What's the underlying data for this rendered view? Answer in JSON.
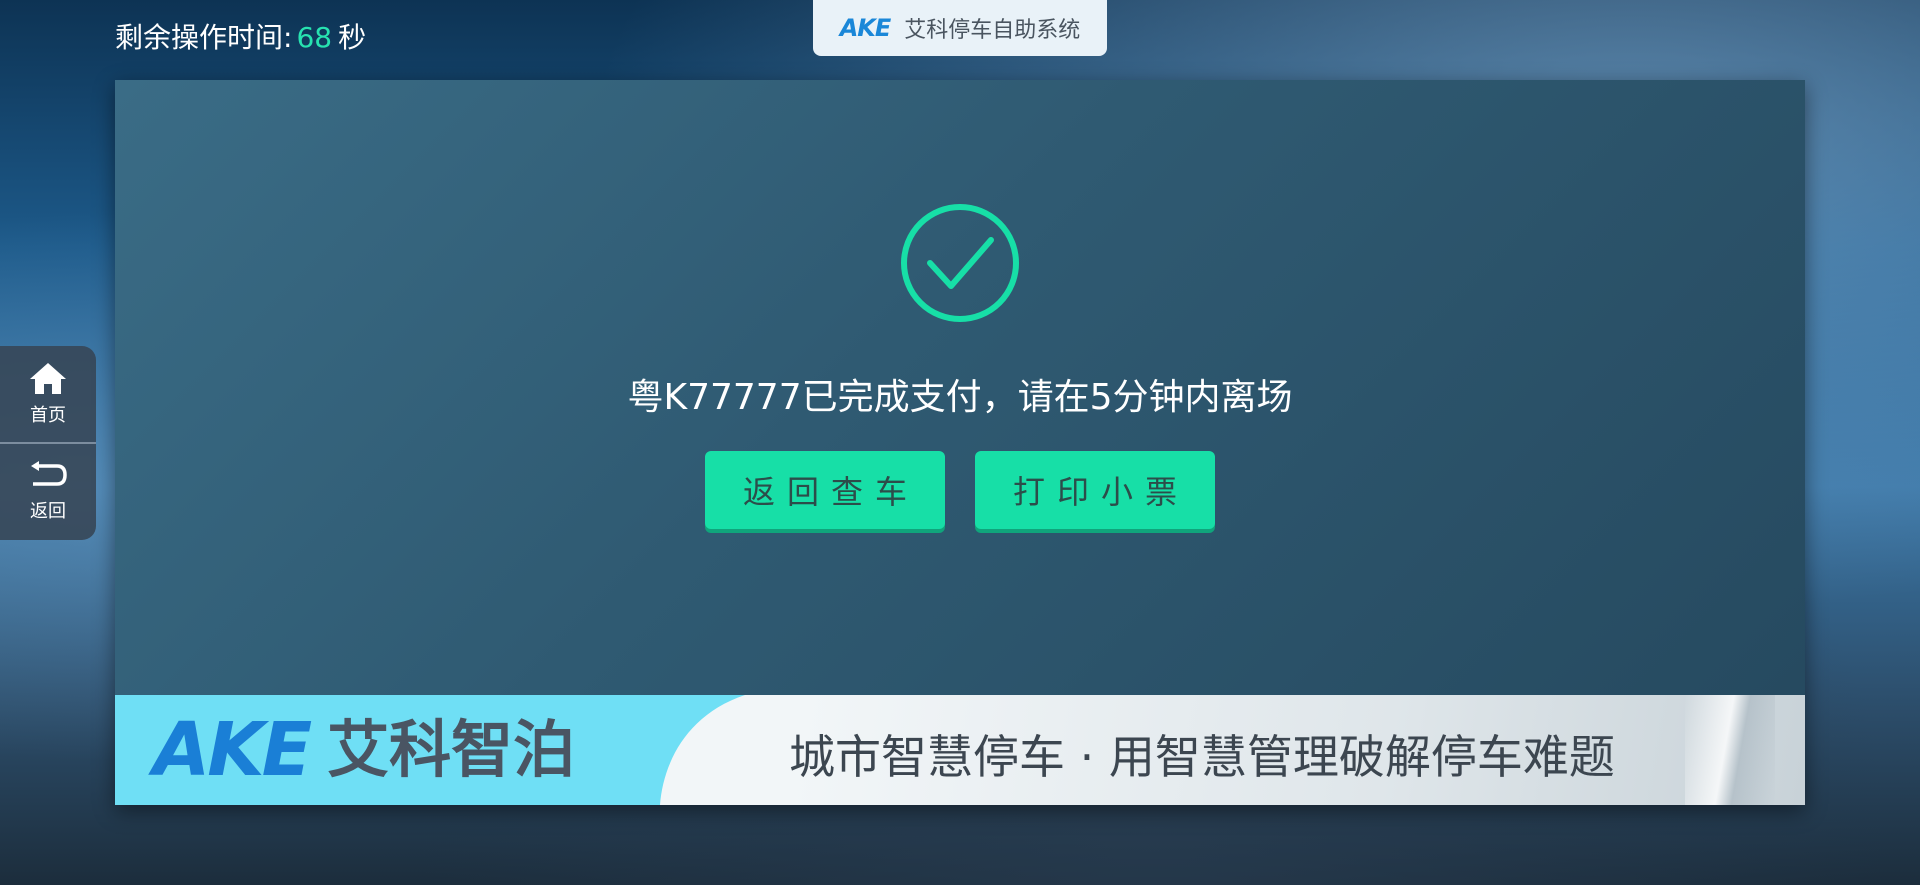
{
  "timer": {
    "label": "剩余操作时间:",
    "seconds": "68",
    "unit": "秒"
  },
  "header": {
    "logo": "AKE",
    "system_name": "艾科停车自助系统"
  },
  "sidebar": {
    "items": [
      {
        "label": "首页",
        "icon": "home-icon"
      },
      {
        "label": "返回",
        "icon": "return-icon"
      }
    ]
  },
  "main": {
    "status_icon": "check-circle-icon",
    "message": "粤K77777已完成支付，请在5分钟内离场",
    "buttons": {
      "back_label": "返回查车",
      "print_label": "打印小票"
    }
  },
  "banner": {
    "logo": "AKE",
    "brand": "艾科智泊",
    "slogan": "城市智慧停车 · 用智慧管理破解停车难题"
  },
  "colors": {
    "accent": "#17dfa7",
    "timer_number": "#27e2b0",
    "brand_blue": "#1a7fd6"
  }
}
